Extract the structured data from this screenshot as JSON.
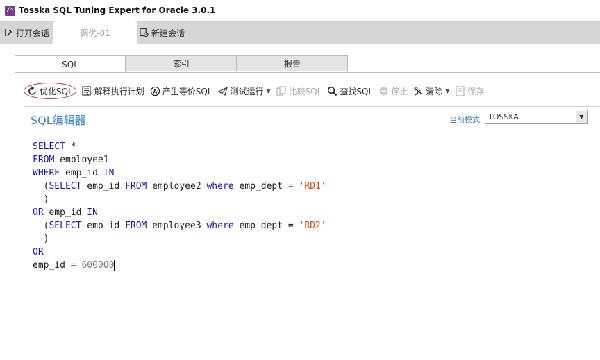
{
  "window": {
    "app_icon_glyph": "/*",
    "title": "Tosska SQL Tuning Expert for Oracle 3.0.1"
  },
  "session_bar": {
    "open_session_label": "打开会话",
    "active_session_tab": "调优-01",
    "new_session_label": "新建会话"
  },
  "tabs": [
    {
      "label": "SQL",
      "active": true
    },
    {
      "label": "索引",
      "active": false
    },
    {
      "label": "报告",
      "active": false
    }
  ],
  "toolbar": {
    "optimize_sql": "优化SQL",
    "explain_plan": "解释执行计划",
    "generate_equiv_sql": "产生等价SQL",
    "test_run": "测试运行",
    "compare_sql": "比较SQL",
    "find_sql": "查找SQL",
    "stop": "停止",
    "clear": "清除",
    "save": "保存"
  },
  "editor": {
    "title": "SQL编辑器",
    "mode_label": "当前模式",
    "mode_value": "TOSSKA"
  },
  "code_lines": [
    [
      {
        "t": "kw",
        "v": "SELECT"
      },
      {
        "t": "id",
        "v": " *"
      }
    ],
    [
      {
        "t": "kw",
        "v": "FROM"
      },
      {
        "t": "id",
        "v": " employee1"
      }
    ],
    [
      {
        "t": "kw",
        "v": "WHERE"
      },
      {
        "t": "id",
        "v": " emp_id "
      },
      {
        "t": "kw",
        "v": "IN"
      }
    ],
    [
      {
        "t": "id",
        "v": "  ("
      },
      {
        "t": "kw",
        "v": "SELECT"
      },
      {
        "t": "id",
        "v": " emp_id "
      },
      {
        "t": "kw",
        "v": "FROM"
      },
      {
        "t": "id",
        "v": " employee2 "
      },
      {
        "t": "kw",
        "v": "where"
      },
      {
        "t": "id",
        "v": " emp_dept = "
      },
      {
        "t": "str",
        "v": "'RD1'"
      }
    ],
    [
      {
        "t": "id",
        "v": "  )"
      }
    ],
    [
      {
        "t": "kw",
        "v": "OR"
      },
      {
        "t": "id",
        "v": " emp_id "
      },
      {
        "t": "kw",
        "v": "IN"
      }
    ],
    [
      {
        "t": "id",
        "v": "  ("
      },
      {
        "t": "kw",
        "v": "SELECT"
      },
      {
        "t": "id",
        "v": " emp_id "
      },
      {
        "t": "kw",
        "v": "FROM"
      },
      {
        "t": "id",
        "v": " employee3 "
      },
      {
        "t": "kw",
        "v": "where"
      },
      {
        "t": "id",
        "v": " emp_dept = "
      },
      {
        "t": "str",
        "v": "'RD2'"
      }
    ],
    [
      {
        "t": "id",
        "v": "  )"
      }
    ],
    [
      {
        "t": "kw",
        "v": "OR"
      }
    ],
    [
      {
        "t": "id",
        "v": "emp_id = "
      },
      {
        "t": "num",
        "v": "600000"
      }
    ]
  ],
  "colors": {
    "keyword": "#1a1aa6",
    "string": "#d04a1a",
    "number": "#777777",
    "accent": "#3b7fc4",
    "highlight_circle": "#c0302b"
  }
}
